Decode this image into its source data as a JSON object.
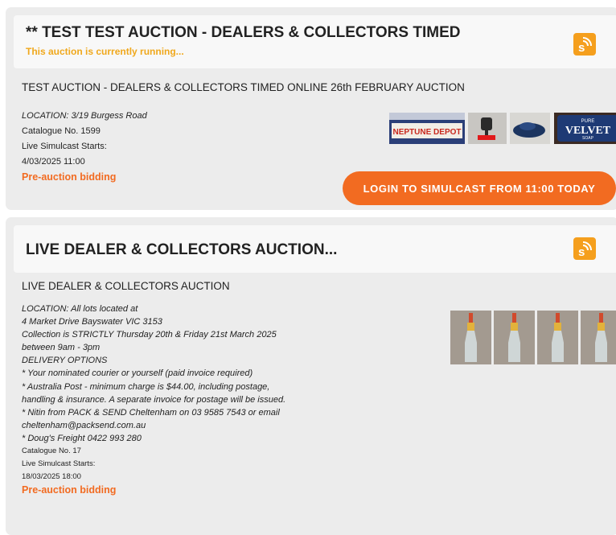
{
  "auctions": [
    {
      "title": "** TEST TEST AUCTION - DEALERS & COLLECTORS TIMED",
      "status": "This auction is currently running...",
      "subtitle": "TEST AUCTION - DEALERS & COLLECTORS TIMED ONLINE 26th FEBRUARY AUCTION",
      "location": "LOCATION: 3/19 Burgess Road",
      "catalogue": "Catalogue No. 1599",
      "simulcast_label": "Live Simulcast Starts:",
      "simulcast_date": "4/03/2025 11:00",
      "bidding": "Pre-auction bidding",
      "login_button": "LOGIN TO SIMULCAST FROM 11:00 TODAY",
      "thumbnails": [
        "neptune-depot-sign",
        "black-ornament",
        "blue-car-model",
        "pure-velvet-soap-sign"
      ],
      "thumbnail_text": {
        "neptune": "NEPTUNE DEPOT",
        "pure": "PURE",
        "velvet": "VELVET",
        "soap": "SOAP"
      }
    },
    {
      "title": "LIVE DEALER & COLLECTORS AUCTION...",
      "subtitle": "LIVE DEALER & COLLECTORS AUCTION",
      "details": [
        "LOCATION: All lots located at",
        "4 Market Drive Bayswater VIC 3153",
        "Collection is STRICTLY Thursday 20th & Friday 21st March 2025",
        "between 9am - 3pm",
        "DELIVERY OPTIONS",
        "* Your nominated courier or yourself (paid invoice required)",
        "* Australia Post - minimum charge is $44.00, including postage,",
        "handling & insurance. A separate invoice for postage will be issued.",
        "* Nitin from PACK & SEND Cheltenham on 03 9585 7543 or email",
        "cheltenham@packsend.com.au",
        "* Doug's Freight 0422 993 280"
      ],
      "catalogue": "Catalogue No. 17",
      "simulcast_label": "Live Simulcast Starts:",
      "simulcast_date": "18/03/2025 18:00",
      "bidding": "Pre-auction bidding",
      "thumbnails": [
        "oil-bottle-1",
        "oil-bottle-2",
        "oil-bottle-3",
        "oil-bottle-4"
      ]
    }
  ],
  "icons": {
    "rss": "rss-s-icon"
  },
  "colors": {
    "accent_orange": "#f26b21",
    "status_yellow": "#f0a81c",
    "rss_orange": "#f59f1d"
  }
}
